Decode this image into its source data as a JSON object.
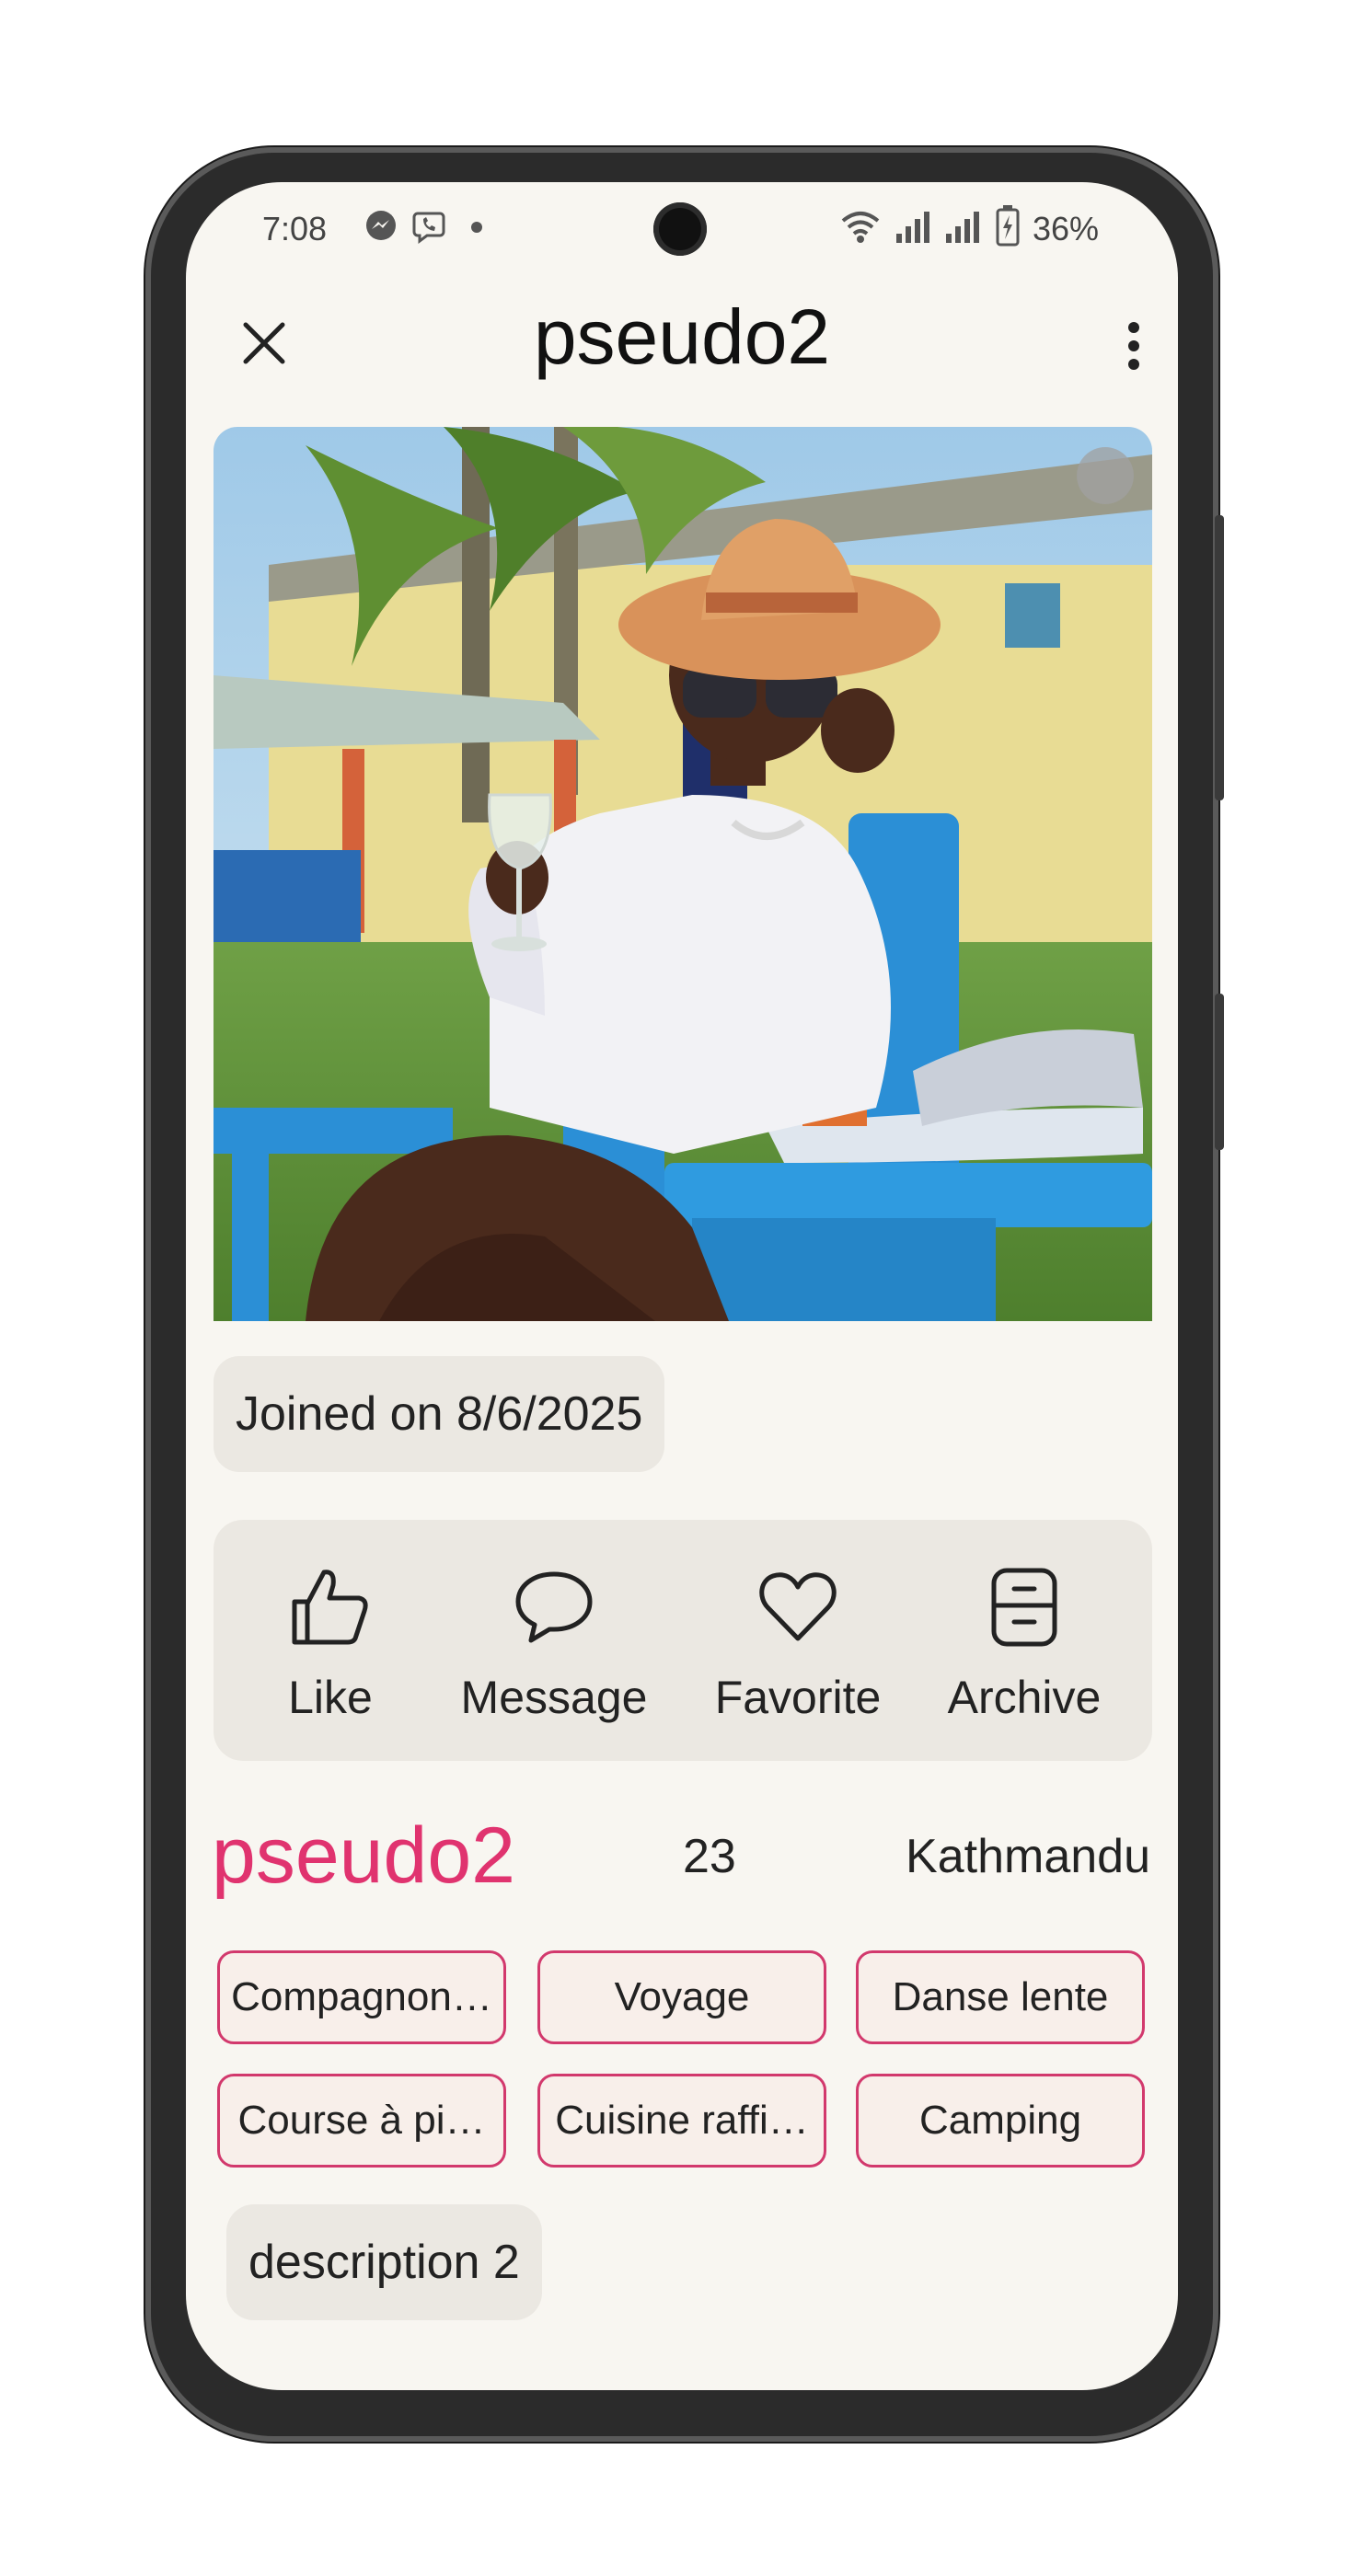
{
  "status_bar": {
    "time": "7:08",
    "battery_percent": "36%",
    "icons": [
      "messenger-icon",
      "viber-icon",
      "dot-icon",
      "wifi-icon",
      "signal-icon",
      "signal-icon",
      "battery-charging-icon"
    ]
  },
  "header": {
    "title": "pseudo2",
    "close_icon": "close-icon",
    "menu_icon": "more-vertical-icon"
  },
  "joined": "Joined on 8/6/2025",
  "actions": [
    {
      "label": "Like",
      "icon": "thumbs-up-icon"
    },
    {
      "label": "Message",
      "icon": "chat-bubble-icon"
    },
    {
      "label": "Favorite",
      "icon": "heart-icon"
    },
    {
      "label": "Archive",
      "icon": "archive-icon"
    }
  ],
  "profile": {
    "name": "pseudo2",
    "age": "23",
    "city": "Kathmandu"
  },
  "tags": [
    "Compagnon…",
    "Voyage",
    "Danse lente",
    "Course à pi…",
    "Cuisine raffi…",
    "Camping"
  ],
  "description": "description 2",
  "colors": {
    "accent": "#e0336f",
    "tag_border": "#d2396d",
    "background": "#f8f6f1",
    "chip": "#ebe8e2"
  }
}
